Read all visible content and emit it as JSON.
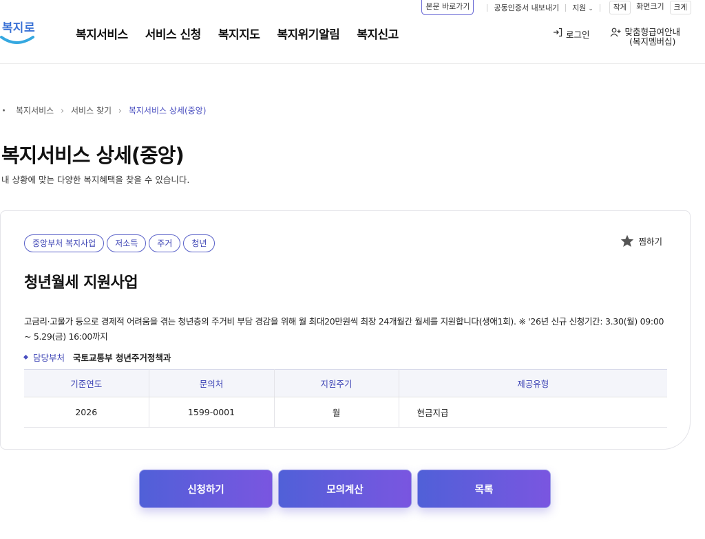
{
  "utility": {
    "skip_link": "본문 바로가기",
    "cert_export": "공동인증서 내보내기",
    "support": "지원",
    "font_small": "작게",
    "font_mid": "화면크기",
    "font_large": "크게"
  },
  "logo": {
    "text": "복지로"
  },
  "nav": [
    "복지서비스",
    "서비스 신청",
    "복지지도",
    "복지위기알림",
    "복지신고"
  ],
  "header_right": {
    "login": "로그인",
    "custom_line1": "맞춤형급여안내",
    "custom_line2": "(복지멤버십)"
  },
  "breadcrumb": [
    "복지서비스",
    "서비스 찾기",
    "복지서비스 상세(중앙)"
  ],
  "page": {
    "title": "복지서비스 상세(중앙)",
    "subtitle": "내 상황에 맞는 다양한 복지혜택을 찾을 수 있습니다."
  },
  "service": {
    "tags": [
      "중앙부처 복지사업",
      "저소득",
      "주거",
      "청년"
    ],
    "favorite": "찜하기",
    "title": "청년월세 지원사업",
    "description": "고금리·고물가 등으로 경제적 어려움을 겪는 청년층의 주거비 부담 경감을 위해 월 최대20만원씩 최장 24개월간 월세를 지원합니다(생애1회). ※ '26년 신규 신청기간: 3.30(월) 09:00 ~ 5.29(금) 16:00까지",
    "dept_label": "담당부처",
    "dept_value": "국토교통부 청년주거정책과",
    "table": {
      "headers": [
        "기준연도",
        "문의처",
        "지원주기",
        "제공유형"
      ],
      "row": [
        "2026",
        "1599-0001",
        "월",
        "현금지급"
      ]
    }
  },
  "actions": [
    "신청하기",
    "모의계산",
    "목록"
  ],
  "colors": {
    "accent": "#4a4fc0",
    "button_start": "#5060d8",
    "button_end": "#7a56e0"
  }
}
